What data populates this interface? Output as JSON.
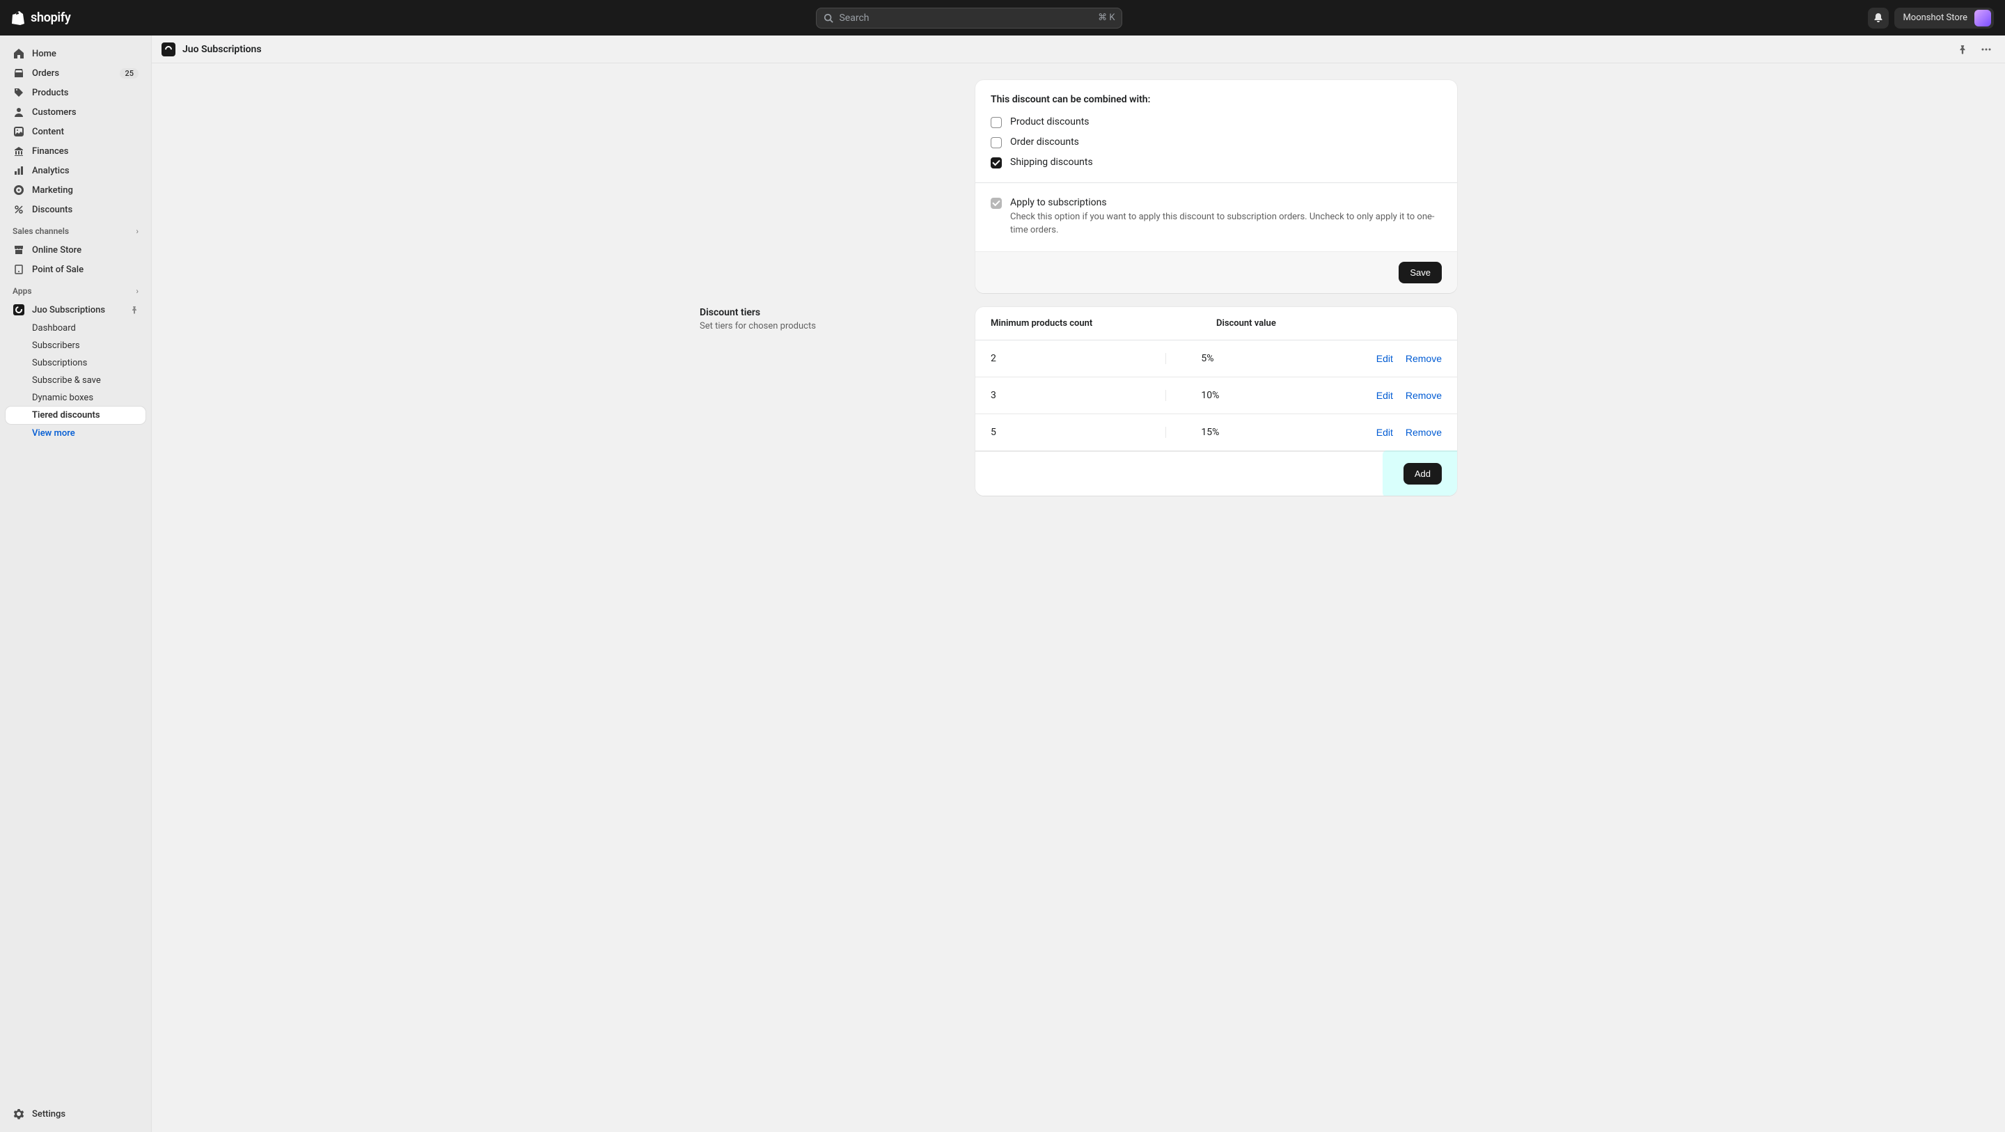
{
  "topbar": {
    "logo_text": "shopify",
    "search_placeholder": "Search",
    "search_shortcut": "⌘ K",
    "store_name": "Moonshot Store"
  },
  "sidebar": {
    "primary": [
      {
        "icon": "home",
        "label": "Home"
      },
      {
        "icon": "orders",
        "label": "Orders",
        "badge": "25"
      },
      {
        "icon": "products",
        "label": "Products"
      },
      {
        "icon": "customers",
        "label": "Customers"
      },
      {
        "icon": "content",
        "label": "Content"
      },
      {
        "icon": "finances",
        "label": "Finances"
      },
      {
        "icon": "analytics",
        "label": "Analytics"
      },
      {
        "icon": "marketing",
        "label": "Marketing"
      },
      {
        "icon": "discounts",
        "label": "Discounts"
      }
    ],
    "sales_channels_label": "Sales channels",
    "sales_channels": [
      {
        "icon": "store",
        "label": "Online Store"
      },
      {
        "icon": "pos",
        "label": "Point of Sale"
      }
    ],
    "apps_label": "Apps",
    "app_name": "Juo Subscriptions",
    "app_sub": [
      {
        "label": "Dashboard"
      },
      {
        "label": "Subscribers"
      },
      {
        "label": "Subscriptions"
      },
      {
        "label": "Subscribe & save"
      },
      {
        "label": "Dynamic boxes"
      },
      {
        "label": "Tiered discounts",
        "selected": true
      }
    ],
    "view_more": "View more",
    "settings": "Settings"
  },
  "page": {
    "app_title": "Juo Subscriptions"
  },
  "combine_card": {
    "title": "This discount can be combined with:",
    "options": [
      {
        "label": "Product discounts",
        "checked": false
      },
      {
        "label": "Order discounts",
        "checked": false
      },
      {
        "label": "Shipping discounts",
        "checked": true
      }
    ],
    "apply_subs_label": "Apply to subscriptions",
    "apply_subs_desc": "Check this option if you want to apply this discount to subscription orders. Uncheck to only apply it to one-time orders.",
    "save_label": "Save"
  },
  "tiers_section": {
    "heading": "Discount tiers",
    "subheading": "Set tiers for chosen products",
    "col_min": "Minimum products count",
    "col_value": "Discount value",
    "rows": [
      {
        "count": "2",
        "value": "5%"
      },
      {
        "count": "3",
        "value": "10%"
      },
      {
        "count": "5",
        "value": "15%"
      }
    ],
    "edit_label": "Edit",
    "remove_label": "Remove",
    "add_label": "Add"
  }
}
